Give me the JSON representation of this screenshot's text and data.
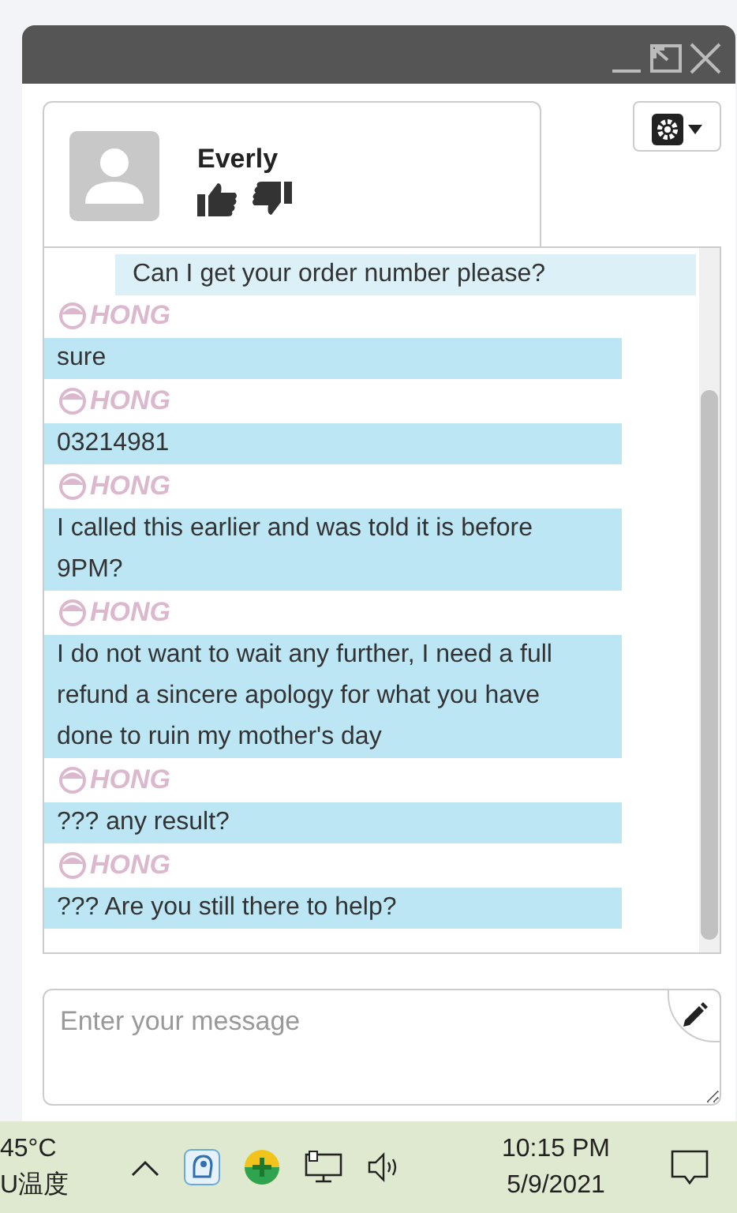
{
  "contact": {
    "name": "Everly"
  },
  "messages": [
    {
      "kind": "agent",
      "text": "Can I get your order number please?"
    },
    {
      "kind": "customer",
      "sender": "HONG",
      "text": "sure"
    },
    {
      "kind": "customer",
      "sender": "HONG",
      "text": "03214981"
    },
    {
      "kind": "customer",
      "sender": "HONG",
      "text": "I called this earlier and was told it is before 9PM?"
    },
    {
      "kind": "customer",
      "sender": "HONG",
      "text": "I do not want to wait any further, I need a full refund a sincere apology for what you have done to ruin my mother's day"
    },
    {
      "kind": "customer",
      "sender": "HONG",
      "text": "??? any result?"
    },
    {
      "kind": "customer",
      "sender": "HONG",
      "text": "??? Are you still there to help?"
    }
  ],
  "composer": {
    "placeholder": "Enter your message"
  },
  "taskbar": {
    "temperature": "45°C",
    "sensor_label": "U温度",
    "time": "10:15 PM",
    "date": "5/9/2021"
  }
}
